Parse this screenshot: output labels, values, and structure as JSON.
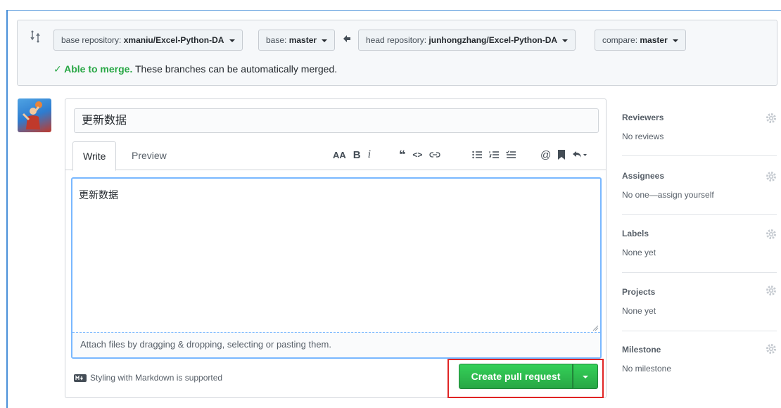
{
  "compare": {
    "base_repo_label": "base repository:",
    "base_repo_value": "xmaniu/Excel-Python-DA",
    "base_label": "base:",
    "base_value": "master",
    "head_repo_label": "head repository:",
    "head_repo_value": "junhongzhang/Excel-Python-DA",
    "compare_label": "compare:",
    "compare_value": "master",
    "merge_ok": "✓ Able to merge.",
    "merge_msg": "These branches can be automatically merged."
  },
  "form": {
    "title_value": "更新数据",
    "tabs": [
      {
        "label": "Write"
      },
      {
        "label": "Preview"
      }
    ],
    "toolbar": {
      "header": "AA",
      "bold": "B",
      "italic": "i",
      "quote": "❝",
      "code": "<>",
      "link": "🔗",
      "at": "@"
    },
    "body_value": "更新数据",
    "attach_text": "Attach files by dragging & dropping, selecting or pasting them.",
    "markdown_note": "Styling with Markdown is supported",
    "create_label": "Create pull request"
  },
  "sidebar": {
    "sections": [
      {
        "heading": "Reviewers",
        "value": "No reviews"
      },
      {
        "heading": "Assignees",
        "value": "No one—assign yourself"
      },
      {
        "heading": "Labels",
        "value": "None yet"
      },
      {
        "heading": "Projects",
        "value": "None yet"
      },
      {
        "heading": "Milestone",
        "value": "No milestone"
      }
    ]
  },
  "colors": {
    "accent_green": "#28a745",
    "focus_blue": "#79b8ff",
    "highlight_red": "#e02424"
  }
}
